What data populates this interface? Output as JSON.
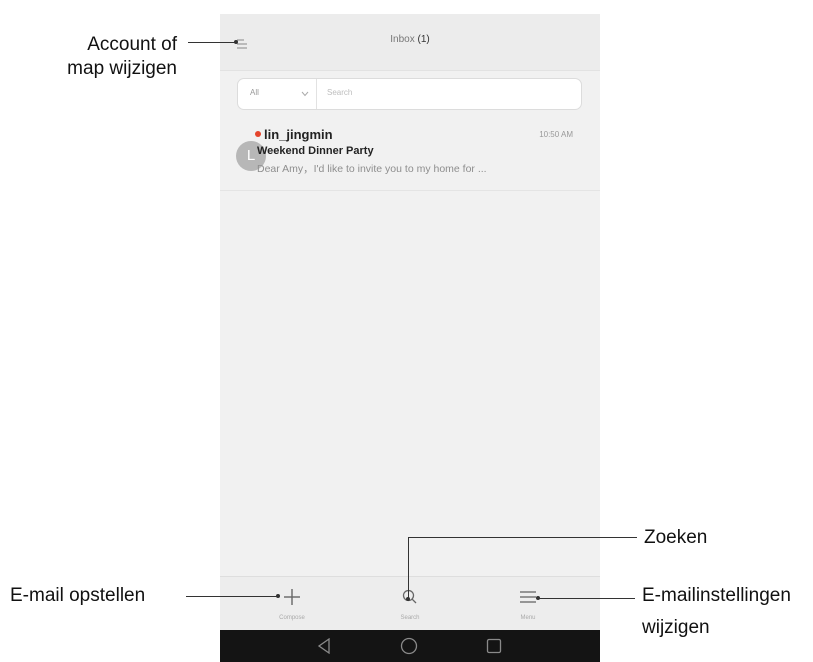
{
  "header": {
    "title": "Inbox",
    "unread": "(1)"
  },
  "search": {
    "filter": "All",
    "placeholder": "Search"
  },
  "mail": {
    "avatar": "L",
    "sender": "lin_jingmin",
    "time": "10:50 AM",
    "subject": "Weekend Dinner Party",
    "preview": "Dear Amy，I'd like to invite you to my home for ..."
  },
  "toolbar": {
    "compose": "Compose",
    "search": "Search",
    "menu": "Menu"
  },
  "callouts": {
    "account_line1": "Account of",
    "account_line2": "map wijzigen",
    "search": "Zoeken",
    "compose": "E-mail opstellen",
    "settings_line1": "E-mailinstellingen",
    "settings_line2": "wijzigen"
  },
  "colors": {
    "unread_dot": "#e5452c",
    "avatar": "#b7b7b7",
    "navbar": "#141414"
  },
  "icons": [
    "menu-icon",
    "chevron-down-icon",
    "plus-icon",
    "search-icon",
    "hamburger-icon",
    "back-icon",
    "home-icon",
    "recent-apps-icon"
  ]
}
